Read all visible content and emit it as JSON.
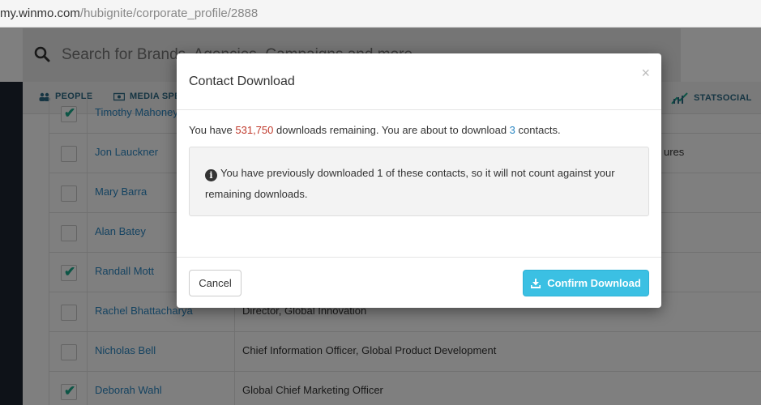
{
  "browser": {
    "url_domain": "my.winmo.com",
    "url_path": "/hubignite/corporate_profile/2888"
  },
  "search": {
    "placeholder": "Search for Brands, Agencies, Campaigns and more..."
  },
  "tabs": [
    {
      "label": "PEOPLE",
      "icon": "people-icon"
    },
    {
      "label": "MEDIA SPEND",
      "icon": "media-spend-icon"
    },
    {
      "label": "STATSOCIAL",
      "icon": "statsocial-icon"
    }
  ],
  "table": {
    "rows": [
      {
        "name": "Timothy Mahoney",
        "title": "",
        "checked": true
      },
      {
        "name": "Jon Lauckner",
        "title": "ures",
        "checked": false
      },
      {
        "name": "Mary Barra",
        "title": "",
        "checked": false
      },
      {
        "name": "Alan Batey",
        "title": "",
        "checked": false
      },
      {
        "name": "Randall Mott",
        "title": "",
        "checked": true
      },
      {
        "name": "Rachel Bhattacharya",
        "title": "Director, Global Innovation",
        "checked": false
      },
      {
        "name": "Nicholas Bell",
        "title": "Chief Information Officer, Global Product Development",
        "checked": false
      },
      {
        "name": "Deborah Wahl",
        "title": "Global Chief Marketing Officer",
        "checked": true
      }
    ]
  },
  "modal": {
    "title": "Contact Download",
    "close": "×",
    "line_prefix": "You have",
    "remaining": "531,750",
    "line_middle": "downloads remaining. You are about to download",
    "count": "3",
    "line_suffix": "contacts.",
    "notice": "You have previously downloaded 1 of these contacts, so it will not count against your remaining downloads.",
    "cancel_label": "Cancel",
    "confirm_label": "Confirm Download"
  },
  "colors": {
    "accent": "#3bc0e3",
    "link": "#2a86c2",
    "remaining_red": "#c0392b",
    "check_green": "#1aaa8c"
  }
}
